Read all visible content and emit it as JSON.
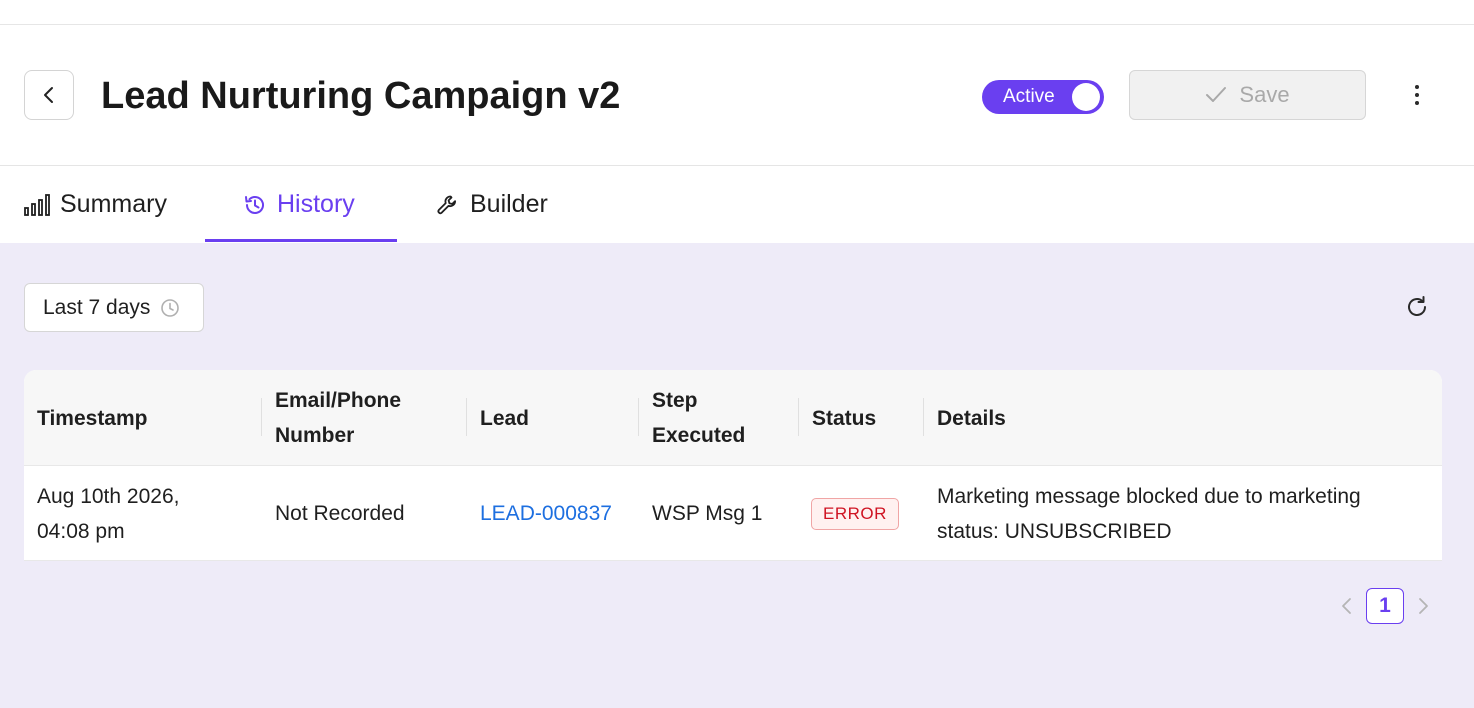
{
  "header": {
    "title": "Lead Nurturing Campaign v2",
    "status_toggle": {
      "label": "Active",
      "on": true
    },
    "save_label": "Save"
  },
  "tabs": [
    {
      "label": "Summary",
      "icon": "bar-chart-icon",
      "active": false
    },
    {
      "label": "History",
      "icon": "history-icon",
      "active": true
    },
    {
      "label": "Builder",
      "icon": "wrench-icon",
      "active": false
    }
  ],
  "filters": {
    "date_range": "Last 7 days"
  },
  "table": {
    "columns": [
      "Timestamp",
      "Email/Phone Number",
      "Lead",
      "Step Executed",
      "Status",
      "Details"
    ],
    "rows": [
      {
        "timestamp": "Aug 10th 2026, 04:08 pm",
        "email_phone": "Not Recorded",
        "lead": "LEAD-000837",
        "step": "WSP Msg 1",
        "status": "ERROR",
        "details": "Marketing message blocked due to marketing status: UNSUBSCRIBED"
      }
    ]
  },
  "pagination": {
    "current_page": "1"
  },
  "colors": {
    "accent": "#6a3ff0",
    "content_background": "#eeebf8",
    "link": "#1d6fe0",
    "error": "#cf1322"
  }
}
